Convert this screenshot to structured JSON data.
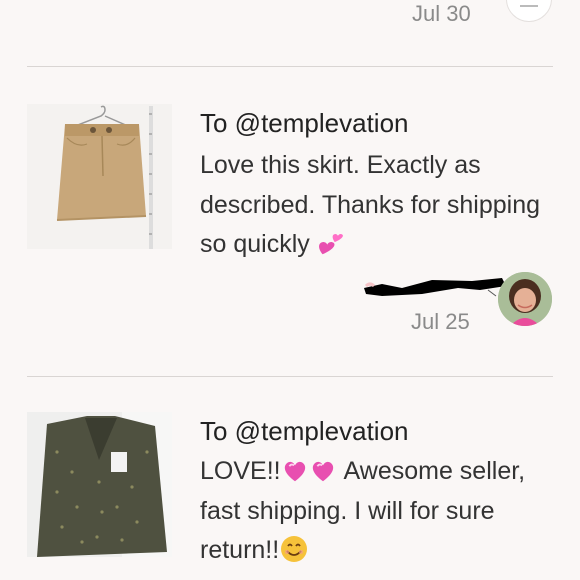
{
  "reviews": [
    {
      "to": "To @templevation",
      "body": "Love this skirt. Exactly as described. Thanks for shipping so quickly",
      "date": "Jul 25",
      "thumb_icon": "tan-corduroy-skirt",
      "emoji": "two-hearts"
    },
    {
      "to": "To @templevation",
      "body_part1": "LOVE!!",
      "body_part2": "Awesome seller, fast shipping. I will for sure return!!",
      "thumb_icon": "olive-sheer-blouse",
      "emoji": [
        "sparkling-heart",
        "sparkling-heart",
        "smiling-face"
      ]
    }
  ],
  "top_date": "Jul 30",
  "colors": {
    "background": "#faf7f6",
    "date_gray": "#8a8a8a",
    "divider": "#d9d5d3",
    "heart_pink": "#e84fb0"
  }
}
